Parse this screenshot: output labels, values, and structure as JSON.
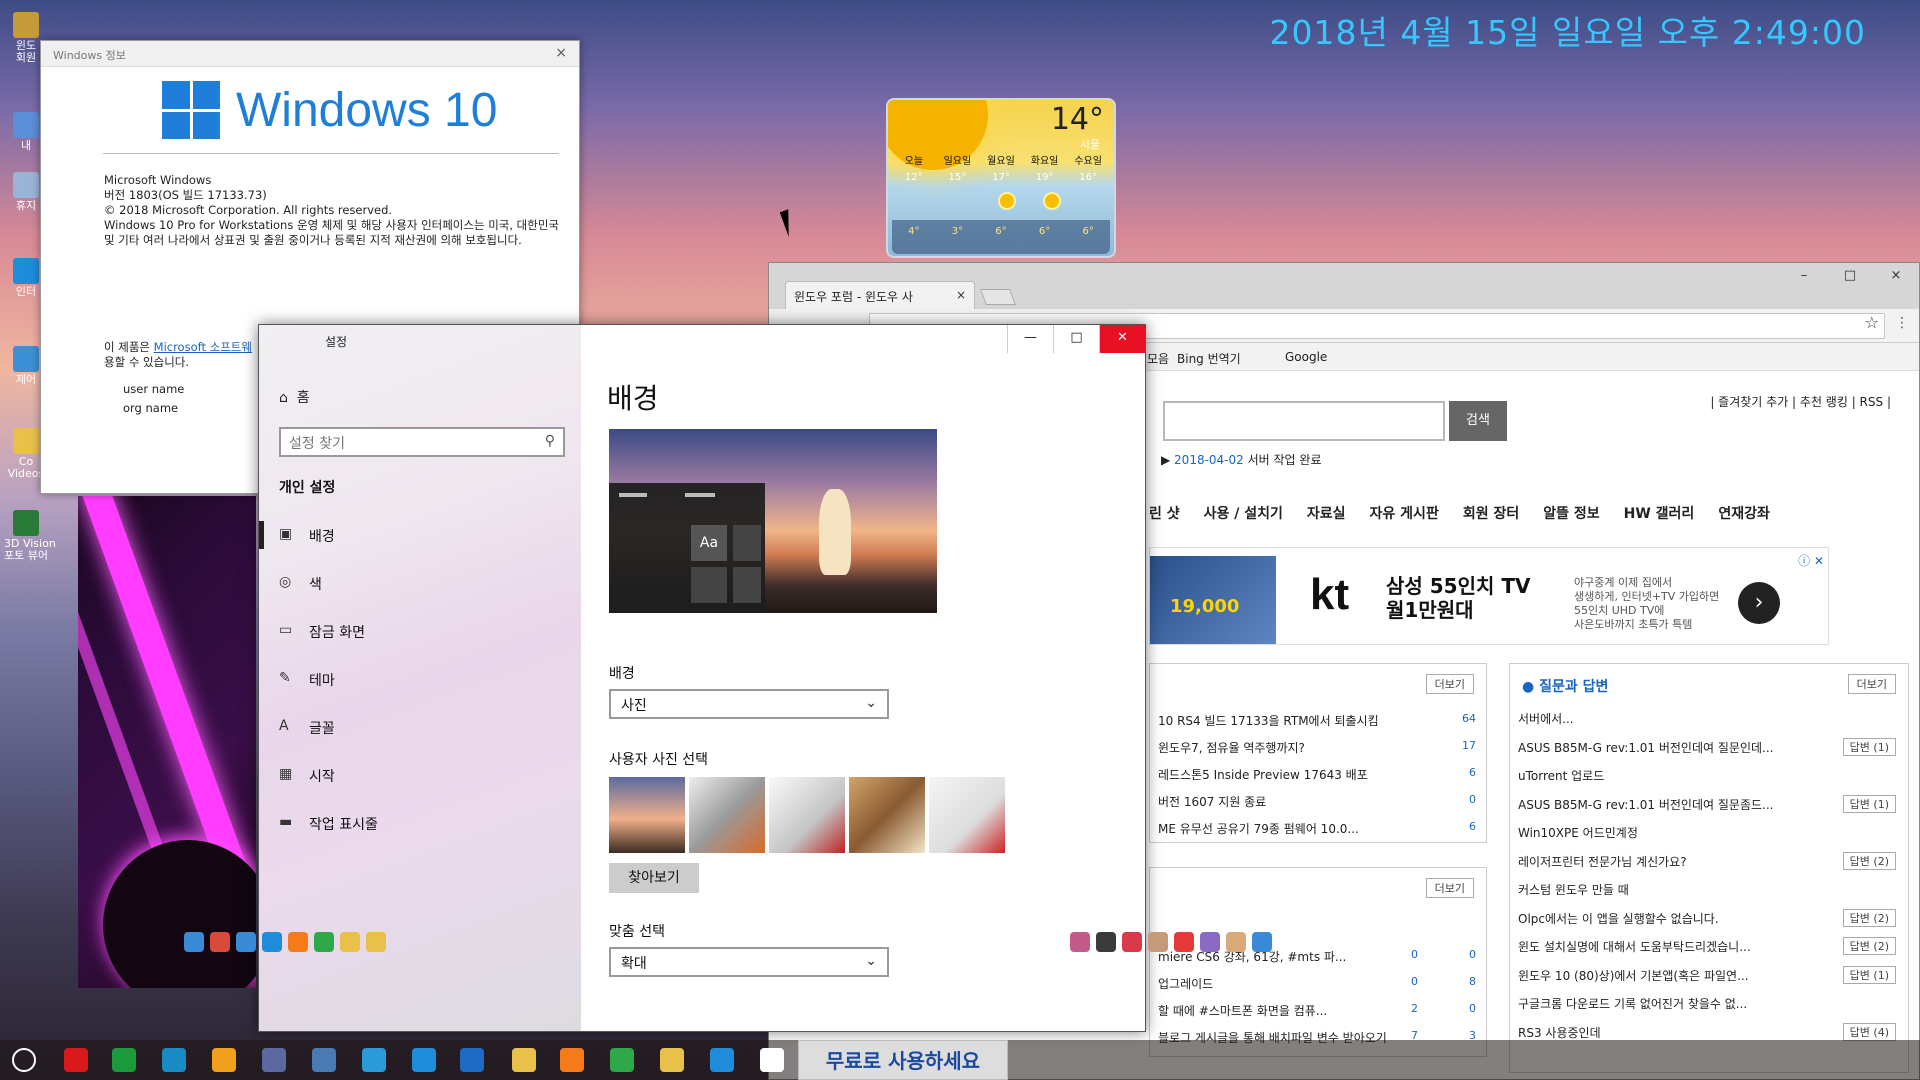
{
  "desktop": {
    "clock": "2018년 4월 15일 일요일 오후 2:49:00",
    "icons": [
      {
        "label": "윈도\n회원",
        "icon": "user-folder-icon",
        "color": "#c49a3a"
      },
      {
        "label": "내",
        "icon": "pc-icon",
        "color": "#5b8ed6"
      },
      {
        "label": "휴지",
        "icon": "recycle-bin-icon",
        "color": "#9ab4d8"
      },
      {
        "label": "인터",
        "icon": "ie-icon",
        "color": "#1e8cd8"
      },
      {
        "label": "제어",
        "icon": "control-panel-icon",
        "color": "#3d8fd6"
      },
      {
        "label": "Co\nVideos",
        "icon": "folder-icon",
        "color": "#e8c04a"
      },
      {
        "label": "3D Vision\n포토 뷰어",
        "icon": "3d-vision-icon",
        "color": "#2a7a3a"
      }
    ]
  },
  "about": {
    "title": "Windows 정보",
    "product": "Windows 10",
    "lines": [
      "Microsoft Windows",
      "버전 1803(OS 빌드 17133.73)",
      "© 2018 Microsoft Corporation. All rights reserved.",
      "Windows 10 Pro for Workstations 운영 체제 및 해당 사용자 인터페이스는 미국, 대한민국 및 기타 여러 나라에서 상표권 및 출원 중이거나 등록된 지적 재산권에 의해 보호됩니다."
    ],
    "license_prefix": "이 제품은 ",
    "license_link": "Microsoft 소프트웨",
    "license_suffix": "용할 수 있습니다.",
    "user_name": "user name",
    "org_name": "org name",
    "close": "×"
  },
  "weather": {
    "temp": "14°",
    "city": "서울",
    "days": [
      "오늘",
      "일요일",
      "월요일",
      "화요일",
      "수요일"
    ],
    "highs": [
      "12°",
      "15°",
      "17°",
      "19°",
      "16°"
    ],
    "lows": [
      "4°",
      "3°",
      "6°",
      "6°",
      "6°"
    ]
  },
  "browser": {
    "tab_title": "윈도우 포럼 - 윈도우 사",
    "tab_close": "×",
    "window_controls": [
      "–",
      "□",
      "×"
    ],
    "bookmarks": [
      "모음",
      "Bing 번역기",
      "Google"
    ],
    "search_button": "검색",
    "top_links": "| 즐겨찾기 추가 | 추천 랭킹 | RSS |",
    "notice_date": "2018-04-02",
    "notice_text": "서버 작업 완료",
    "nav": [
      "린 샷",
      "사용 / 설치기",
      "자료실",
      "자유 게시판",
      "회원 장터",
      "알뜰 정보",
      "HW 갤러리",
      "연재강좌"
    ],
    "ad": {
      "banner_price": "19,000",
      "brand": "kt",
      "headline1": "삼성 55인치 TV",
      "headline2": "월1만원대",
      "sub": "야구중계 이제 집에서\n생생하게, 인터넷+TV 가입하면\n55인치 UHD TV에\n사은도바까지 초특가 특템",
      "next": "›",
      "info": "ⓘ ✕"
    },
    "more": "더보기",
    "news": [
      {
        "text": "10 RS4 빌드 17133을 RTM에서 퇴출시킴",
        "count": "64"
      },
      {
        "text": "윈도우7, 점유율 역주행까지?",
        "count": "17"
      },
      {
        "text": "레드스톤5 Inside Preview 17643 배포",
        "count": "6"
      },
      {
        "text": "버전 1607 지원 종료",
        "count": "0"
      },
      {
        "text": "ME 유무선 공유기 79종 펌웨어 10.0...",
        "count": "6"
      }
    ],
    "lower": [
      {
        "text": "miere CS6 강좌, 61강, #mts 파...",
        "likes": "0",
        "count": "0"
      },
      {
        "text": "업그레이드",
        "likes": "0",
        "count": "8"
      },
      {
        "text": "할 때에 #스마트폰 화면을 컴퓨...",
        "likes": "2",
        "count": "0"
      },
      {
        "text": "블로그 게시글을 통해 배치파일 변수 받아오기",
        "likes": "7",
        "count": "3"
      }
    ],
    "qa_title": "질문과 답변",
    "qa": [
      {
        "text": "서버에서...",
        "ans": ""
      },
      {
        "text": "ASUS B85M-G rev:1.01 버전인데여 질문인데...",
        "ans": "답변 (1)"
      },
      {
        "text": "uTorrent 업로드",
        "ans": ""
      },
      {
        "text": "ASUS B85M-G rev:1.01 버전인데여 질문좀드...",
        "ans": "답변 (1)"
      },
      {
        "text": "Win10XPE 어드민계정",
        "ans": ""
      },
      {
        "text": "레이저프린터 전문가님 계신가요?",
        "ans": "답변 (2)"
      },
      {
        "text": "커스텀 윈도우 만들 때",
        "ans": ""
      },
      {
        "text": "Olpc에서는 이 앱을 실행할수 없습니다.",
        "ans": "답변 (2)"
      },
      {
        "text": "윈도 설치실명에 대해서 도움부탁드리겠습니...",
        "ans": "답변 (2)"
      },
      {
        "text": "윈도우 10 (80)상)에서 기본앱(혹은 파일연...",
        "ans": "답변 (1)"
      },
      {
        "text": "구글크롬 다운로드 기록 없어진거 찾을수 없...",
        "ans": ""
      },
      {
        "text": "RS3 사용중인데",
        "ans": "답변 (4)"
      }
    ],
    "answer_label": "답변 (1)"
  },
  "settings": {
    "title": "설정",
    "home": "홈",
    "search_placeholder": "설정 찾기",
    "group": "개인 설정",
    "nav": [
      {
        "label": "배경",
        "icon": "image-icon",
        "glyph": "▣"
      },
      {
        "label": "색",
        "icon": "palette-icon",
        "glyph": "◎"
      },
      {
        "label": "잠금 화면",
        "icon": "lock-screen-icon",
        "glyph": "▭"
      },
      {
        "label": "테마",
        "icon": "theme-icon",
        "glyph": "✎"
      },
      {
        "label": "글꼴",
        "icon": "font-icon",
        "glyph": "A"
      },
      {
        "label": "시작",
        "icon": "start-icon",
        "glyph": "▦"
      },
      {
        "label": "작업 표시줄",
        "icon": "taskbar-icon",
        "glyph": "▬"
      }
    ],
    "heading": "배경",
    "preview_aa": "Aa",
    "bg_label": "배경",
    "bg_value": "사진",
    "photo_label": "사용자 사진 선택",
    "browse": "찾아보기",
    "fit_label": "맞춤 선택",
    "fit_value": "확대",
    "window_controls": [
      "—",
      "□",
      "✕"
    ]
  },
  "taskbar": {
    "notification": "무료로 사용하세요"
  }
}
